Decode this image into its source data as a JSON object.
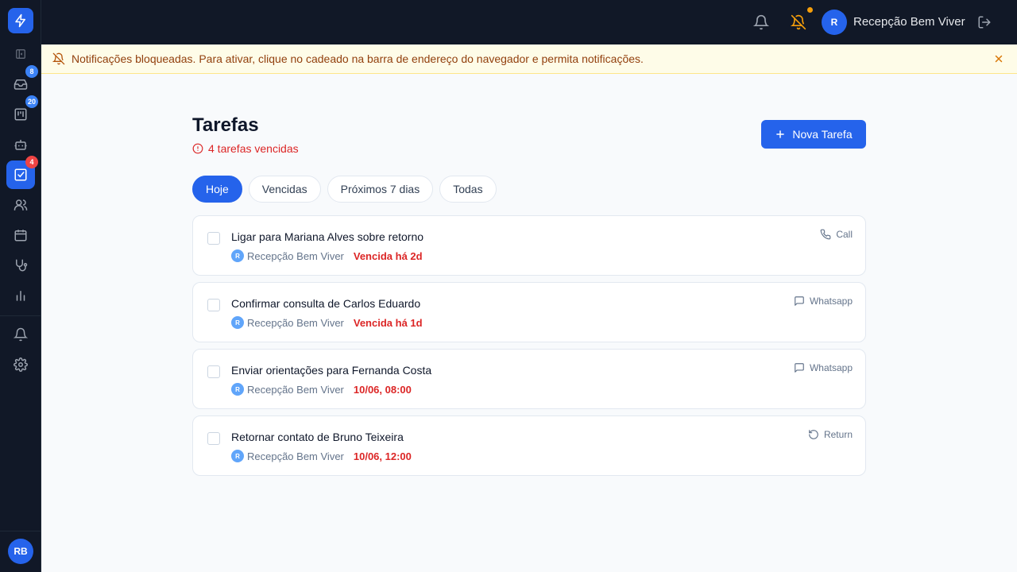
{
  "sidebar": {
    "items": [
      {
        "icon": "panel-toggle-icon"
      },
      {
        "icon": "inbox-icon",
        "badge": "8"
      },
      {
        "icon": "kanban-icon",
        "badge": "20"
      },
      {
        "icon": "bot-icon"
      },
      {
        "icon": "tasks-icon",
        "badge": "4",
        "active": true
      },
      {
        "icon": "users-icon"
      },
      {
        "icon": "calendar-icon"
      },
      {
        "icon": "stethoscope-icon"
      },
      {
        "icon": "chart-icon"
      },
      {
        "icon": "bell-icon"
      },
      {
        "icon": "gear-icon"
      }
    ],
    "user_initials": "RB"
  },
  "topbar": {
    "user_initial": "R",
    "user_name": "Recepção Bem Viver"
  },
  "banner": {
    "text": "Notificações bloqueadas. Para ativar, clique no cadeado na barra de endereço do navegador e permita notificações."
  },
  "page": {
    "title": "Tarefas",
    "overdue_text": "4 tarefas vencidas",
    "new_button_label": "Nova Tarefa"
  },
  "tabs": [
    {
      "label": "Hoje",
      "active": true
    },
    {
      "label": "Vencidas"
    },
    {
      "label": "Próximos 7 dias"
    },
    {
      "label": "Todas"
    }
  ],
  "tasks": [
    {
      "title": "Ligar para Mariana Alves sobre retorno",
      "assignee_initial": "R",
      "assignee": "Recepção Bem Viver",
      "due": "Vencida há 2d",
      "channel": "Call",
      "channel_icon": "phone-icon"
    },
    {
      "title": "Confirmar consulta de Carlos Eduardo",
      "assignee_initial": "R",
      "assignee": "Recepção Bem Viver",
      "due": "Vencida há 1d",
      "channel": "Whatsapp",
      "channel_icon": "message-icon"
    },
    {
      "title": "Enviar orientações para Fernanda Costa",
      "assignee_initial": "R",
      "assignee": "Recepção Bem Viver",
      "due": "10/06, 08:00",
      "channel": "Whatsapp",
      "channel_icon": "message-icon"
    },
    {
      "title": "Retornar contato de Bruno Teixeira",
      "assignee_initial": "R",
      "assignee": "Recepção Bem Viver",
      "due": "10/06, 12:00",
      "channel": "Return",
      "channel_icon": "rotate-icon"
    }
  ],
  "colors": {
    "accent": "#2563eb",
    "danger": "#dc2626",
    "sidebar_bg": "#111827",
    "banner_bg": "#fefce8"
  }
}
